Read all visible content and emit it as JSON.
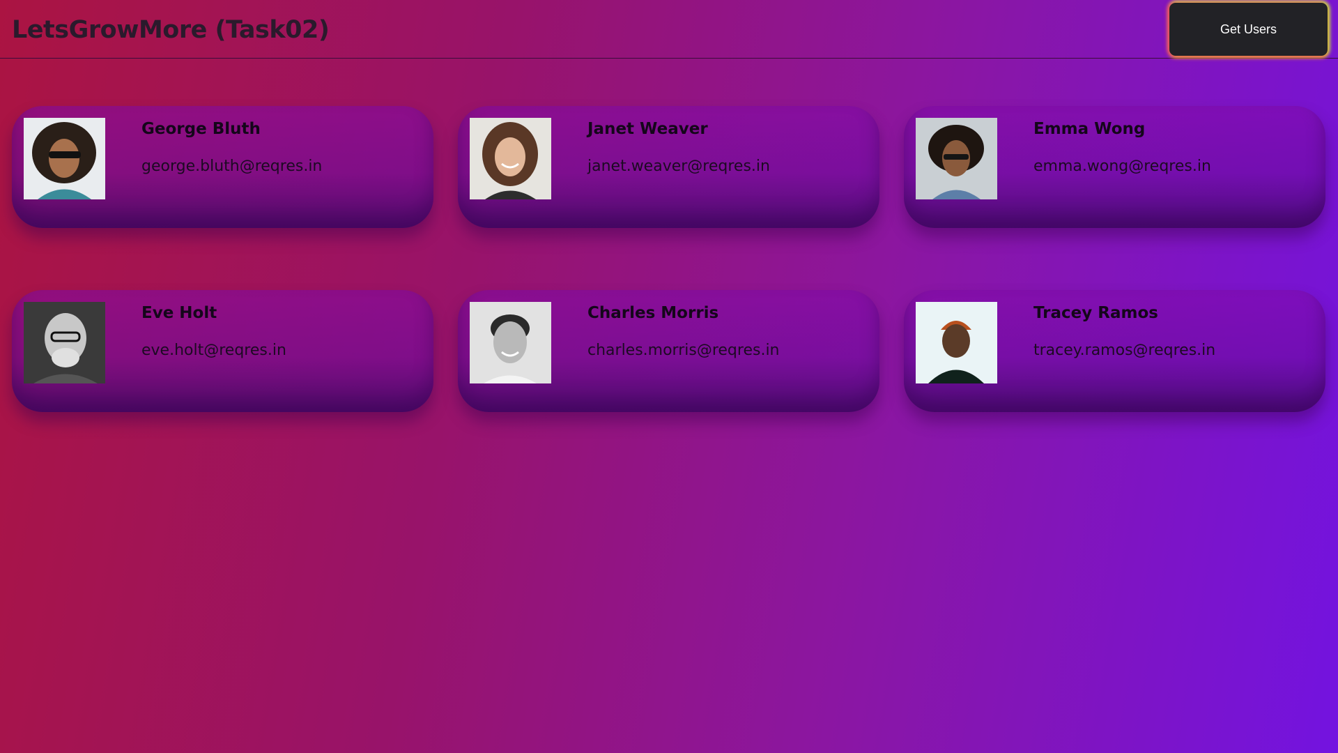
{
  "header": {
    "title": "LetsGrowMore (Task02)",
    "button_label": "Get Users"
  },
  "users": [
    {
      "name": "George Bluth",
      "email": "george.bluth@reqres.in",
      "avatar_icon": "avatar-photo-icon"
    },
    {
      "name": "Janet Weaver",
      "email": "janet.weaver@reqres.in",
      "avatar_icon": "avatar-photo-icon"
    },
    {
      "name": "Emma Wong",
      "email": "emma.wong@reqres.in",
      "avatar_icon": "avatar-photo-icon"
    },
    {
      "name": "Eve Holt",
      "email": "eve.holt@reqres.in",
      "avatar_icon": "avatar-photo-icon"
    },
    {
      "name": "Charles Morris",
      "email": "charles.morris@reqres.in",
      "avatar_icon": "avatar-photo-icon"
    },
    {
      "name": "Tracey Ramos",
      "email": "tracey.ramos@reqres.in",
      "avatar_icon": "avatar-photo-icon"
    }
  ],
  "colors": {
    "button_bg": "#222226",
    "title_text": "#2a1a2c",
    "gradient_start": "#ab1442",
    "gradient_end": "#7313e0"
  }
}
